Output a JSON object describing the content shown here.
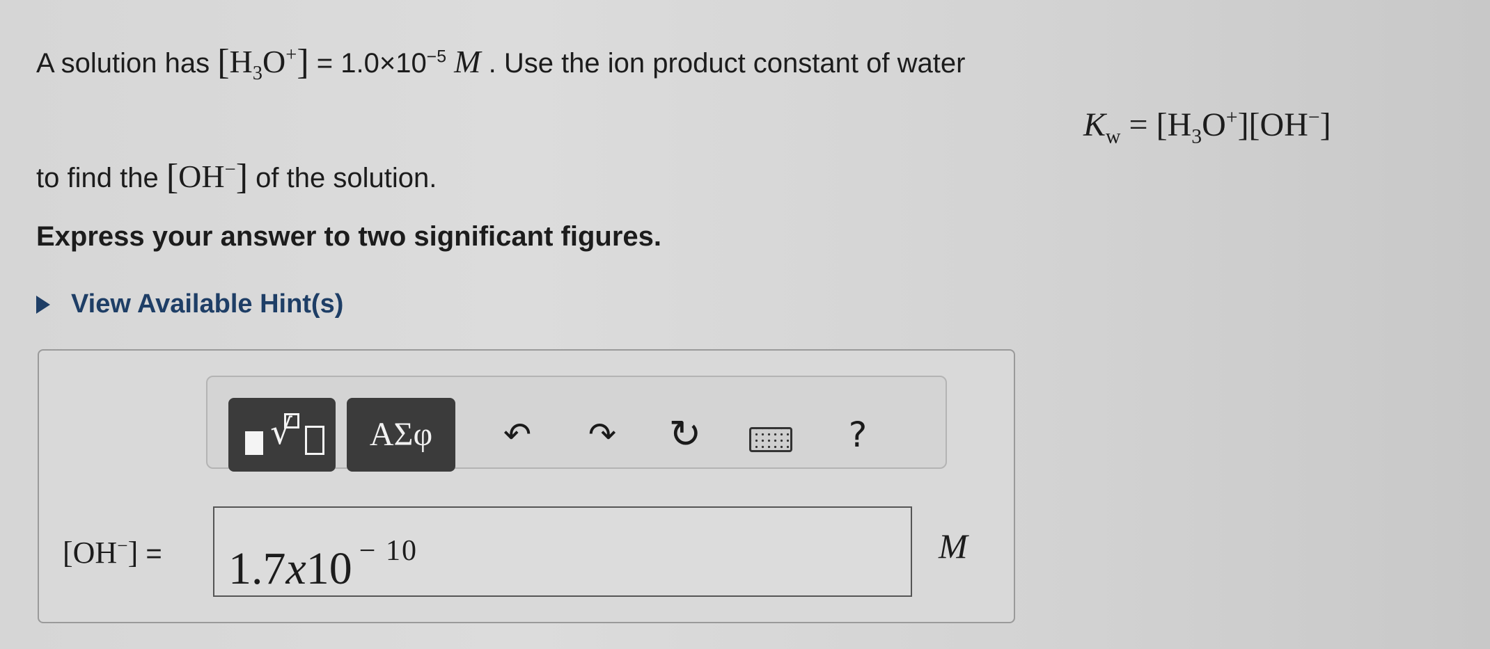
{
  "question": {
    "line1": {
      "prefix": "A solution has",
      "species": "H",
      "species_sub": "3",
      "species_tail": "O",
      "species_sup": "+",
      "equals_value": "= 1.0×10",
      "exponent": "−5",
      "unit": "M",
      "suffix": ". Use the ion product constant of water"
    },
    "kw_eq": {
      "symbol": "K",
      "symbol_sub": "w",
      "eq": "= [H",
      "sub3": "3",
      "o": "O",
      "plus": "+",
      "mid": "][OH",
      "minus": "−",
      "end": "]"
    },
    "line2": {
      "prefix": "to find the",
      "species": "OH",
      "species_sup": "−",
      "suffix": "of the solution."
    },
    "instruction": "Express your answer to two significant figures."
  },
  "hint": {
    "label": "View Available Hint(s)"
  },
  "toolbar": {
    "templates_icon": "templates-icon",
    "symbols_label": "ΑΣφ",
    "undo_icon": "undo-icon",
    "redo_icon": "redo-icon",
    "reset_icon": "reset-icon",
    "keyboard_icon": "keyboard-icon",
    "help_label": "?"
  },
  "answer": {
    "label_species": "OH",
    "label_sup": "−",
    "label_equals": "=",
    "mantissa": "1.7",
    "times": "x",
    "base": "10",
    "exponent": "− 10",
    "unit": "M"
  }
}
